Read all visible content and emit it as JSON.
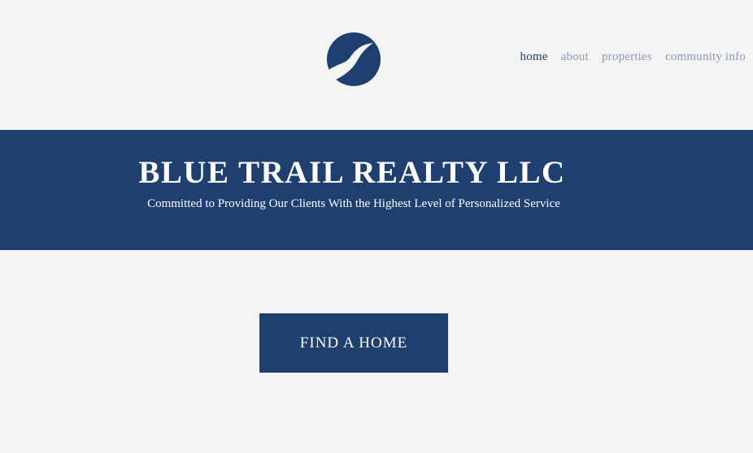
{
  "brand": {
    "logo_icon": "blue-trail-logo-icon",
    "accent_color": "#1f3f71"
  },
  "nav": {
    "items": [
      {
        "label": "home",
        "active": true
      },
      {
        "label": "about",
        "active": false
      },
      {
        "label": "properties",
        "active": false
      },
      {
        "label": "community info",
        "active": false
      }
    ]
  },
  "hero": {
    "title": "BLUE TRAIL REALTY LLC",
    "subtitle": "Committed to Providing Our Clients With the Highest Level of Personalized Service"
  },
  "cta": {
    "label": "FIND A HOME"
  }
}
